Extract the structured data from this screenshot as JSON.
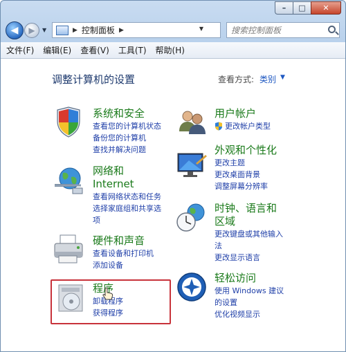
{
  "window": {
    "caption_buttons": [
      "min",
      "max",
      "close"
    ],
    "minimize_glyph": "–",
    "maximize_glyph": "□",
    "close_glyph": "✕"
  },
  "navbar": {
    "back_glyph": "◀",
    "forward_glyph": "▶",
    "history_glyph": "▼",
    "address_separator": "▶",
    "address_text": "控制面板",
    "address_trail": "▶",
    "address_dropdown": "▼",
    "refresh_glyph": "↻",
    "search_placeholder": "搜索控制面板"
  },
  "menu": [
    "文件(F)",
    "编辑(E)",
    "查看(V)",
    "工具(T)",
    "帮助(H)"
  ],
  "main": {
    "title": "调整计算机的设置",
    "view_by_label": "查看方式:",
    "view_by_value": "类别",
    "view_by_caret": "▼"
  },
  "categories": {
    "system_security": {
      "title": "系统和安全",
      "links": [
        "查看您的计算机状态",
        "备份您的计算机",
        "查找并解决问题"
      ]
    },
    "network": {
      "title_line1": "网络和",
      "title_line2": "Internet",
      "links": [
        "查看网络状态和任务",
        "选择家庭组和共享选",
        "项"
      ]
    },
    "hardware_sound": {
      "title": "硬件和声音",
      "links": [
        "查看设备和打印机",
        "添加设备"
      ]
    },
    "programs": {
      "title": "程序",
      "links": [
        "卸载程序",
        "获得程序"
      ]
    },
    "user_accounts": {
      "title": "用户帐户",
      "links": [
        "更改帐户类型"
      ]
    },
    "appearance": {
      "title": "外观和个性化",
      "links": [
        "更改主题",
        "更改桌面背景",
        "调整屏幕分辨率"
      ]
    },
    "clock_region": {
      "title_line1": "时钟、语言和",
      "title_line2": "区域",
      "links": [
        "更改键盘或其他输入",
        "法",
        "更改显示语言"
      ]
    },
    "ease_of_access": {
      "title": "轻松访问",
      "links": [
        "使用 Windows 建议",
        "的设置",
        "优化视频显示"
      ]
    }
  },
  "colors": {
    "category_title": "#1a7a1a",
    "link": "#1f3fa8",
    "highlight_border": "#c8323a",
    "page_title": "#1e3a6e"
  }
}
